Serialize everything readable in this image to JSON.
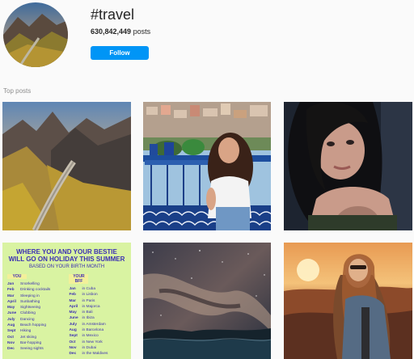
{
  "header": {
    "hashtag": "#travel",
    "post_count": "630,842,449",
    "post_count_suffix": " posts",
    "follow_label": "Follow"
  },
  "section_label": "Top posts",
  "posts": [
    {
      "subject": "mountain trail photo"
    },
    {
      "subject": "woman on terrace with hillside town"
    },
    {
      "subject": "selfie portrait"
    },
    {
      "subject": "holiday infographic",
      "headline_1": "WHERE YOU AND YOUR BESTIE",
      "headline_2": "WILL GO ON HOLIDAY THIS SUMMER",
      "subtitle": "BASED ON YOUR BIRTH MONTH",
      "col_you": "YOU",
      "col_bestie": "YOUR BFF",
      "you_rows": [
        [
          "Jan",
          "Snorkelling"
        ],
        [
          "Feb",
          "Drinking cocktails"
        ],
        [
          "Mar",
          "Sleeping in"
        ],
        [
          "April",
          "Sunbathing"
        ],
        [
          "May",
          "Sightseeing"
        ],
        [
          "June",
          "Clubbing"
        ],
        [
          "July",
          "Dancing"
        ],
        [
          "Aug",
          "Beach hopping"
        ],
        [
          "Sept",
          "Hiking"
        ],
        [
          "Oct",
          "Jet skiing"
        ],
        [
          "Nov",
          "Bar-hopping"
        ],
        [
          "Dec",
          "Seeing sights"
        ]
      ],
      "bff_rows": [
        [
          "Jan",
          "in Cuba"
        ],
        [
          "Feb",
          "in Lisbon"
        ],
        [
          "Mar",
          "in Paris"
        ],
        [
          "April",
          "in Majorca"
        ],
        [
          "May",
          "in Bali"
        ],
        [
          "June",
          "in Ibiza"
        ],
        [
          "July",
          "in Amsterdam"
        ],
        [
          "Aug",
          "in Barcelona"
        ],
        [
          "Sept",
          "in Mexico"
        ],
        [
          "Oct",
          "in New York"
        ],
        [
          "Nov",
          "in Dubai"
        ],
        [
          "Dec",
          "in the Maldives"
        ]
      ]
    },
    {
      "subject": "milky way over coast"
    },
    {
      "subject": "woman at sunset"
    }
  ],
  "colors": {
    "follow_bg": "#0095f6",
    "accent_text": "#3b2fb3",
    "infographic_bg": "#d9f3a2"
  }
}
